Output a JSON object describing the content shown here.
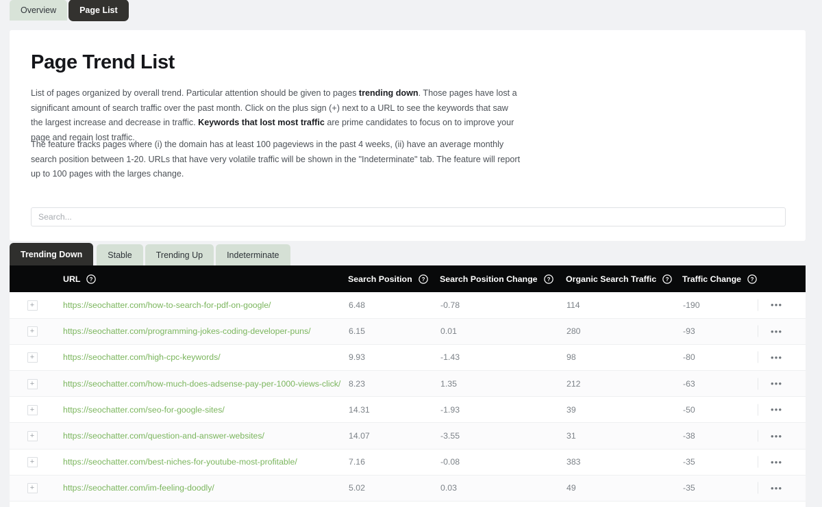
{
  "top_tabs": [
    {
      "label": "Overview",
      "active": false
    },
    {
      "label": "Page List",
      "active": true
    }
  ],
  "card": {
    "title": "Page Trend List",
    "paragraph1_part1": "List of pages organized by overall trend. Particular attention should be given to pages ",
    "paragraph1_bold1": "trending down",
    "paragraph1_part2": ". Those pages have lost a significant amount of search traffic over the past month. Click on the plus sign (+) next to a URL to see the keywords that saw the largest increase and decrease in traffic. ",
    "paragraph1_bold2": "Keywords that lost most traffic",
    "paragraph1_part3": " are prime candidates to focus on to improve your page and regain lost traffic.",
    "paragraph2": "The feature tracks pages where (i) the domain has at least 100 pageviews in the past 4 weeks, (ii) have an average monthly search position between 1-20. URLs that have very volatile traffic will be shown in the \"Indeterminate\" tab. The feature will report up to 100 pages with the larges change."
  },
  "search": {
    "placeholder": "Search...",
    "value": ""
  },
  "filter_tabs": [
    {
      "label": "Trending Down",
      "active": true
    },
    {
      "label": "Stable",
      "active": false
    },
    {
      "label": "Trending Up",
      "active": false
    },
    {
      "label": "Indeterminate",
      "active": false
    }
  ],
  "table": {
    "columns": [
      {
        "label": "URL",
        "help": "help-circle-icon"
      },
      {
        "label": "Search Position",
        "help": "help-circle-icon"
      },
      {
        "label": "Search Position Change",
        "help": "help-circle-icon"
      },
      {
        "label": "Organic Search Traffic",
        "help": "help-circle-icon"
      },
      {
        "label": "Traffic Change",
        "help": "help-circle-icon"
      }
    ],
    "expand_label": "+",
    "menu_label": "•••",
    "rows": [
      {
        "url": "https://seochatter.com/how-to-search-for-pdf-on-google/",
        "search_position": "6.48",
        "search_position_change": "-0.78",
        "organic_search_traffic": "114",
        "traffic_change": "-190"
      },
      {
        "url": "https://seochatter.com/programming-jokes-coding-developer-puns/",
        "search_position": "6.15",
        "search_position_change": "0.01",
        "organic_search_traffic": "280",
        "traffic_change": "-93"
      },
      {
        "url": "https://seochatter.com/high-cpc-keywords/",
        "search_position": "9.93",
        "search_position_change": "-1.43",
        "organic_search_traffic": "98",
        "traffic_change": "-80"
      },
      {
        "url": "https://seochatter.com/how-much-does-adsense-pay-per-1000-views-click/",
        "search_position": "8.23",
        "search_position_change": "1.35",
        "organic_search_traffic": "212",
        "traffic_change": "-63"
      },
      {
        "url": "https://seochatter.com/seo-for-google-sites/",
        "search_position": "14.31",
        "search_position_change": "-1.93",
        "organic_search_traffic": "39",
        "traffic_change": "-50"
      },
      {
        "url": "https://seochatter.com/question-and-answer-websites/",
        "search_position": "14.07",
        "search_position_change": "-3.55",
        "organic_search_traffic": "31",
        "traffic_change": "-38"
      },
      {
        "url": "https://seochatter.com/best-niches-for-youtube-most-profitable/",
        "search_position": "7.16",
        "search_position_change": "-0.08",
        "organic_search_traffic": "383",
        "traffic_change": "-35"
      },
      {
        "url": "https://seochatter.com/im-feeling-doodly/",
        "search_position": "5.02",
        "search_position_change": "0.03",
        "organic_search_traffic": "49",
        "traffic_change": "-35"
      }
    ]
  },
  "colors": {
    "page_background": "#f1f2f4",
    "card_background": "#ffffff",
    "tab_active": "#2f2f2d",
    "tab_inactive": "#d5e0d5",
    "table_header": "#08090a",
    "link_green": "#7ab55c",
    "body_text": "#4c5157",
    "muted_text": "#7c8288"
  }
}
